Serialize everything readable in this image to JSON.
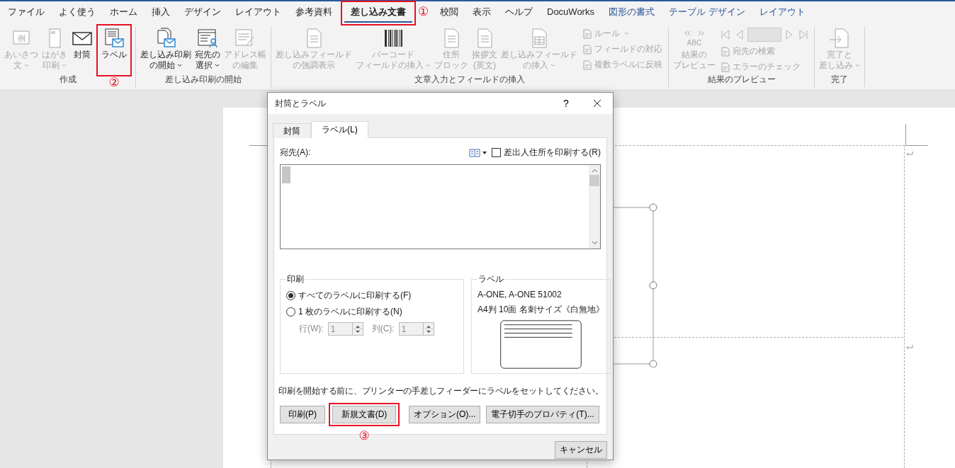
{
  "ribbon_tabs": [
    {
      "label": "ファイル",
      "selected": false,
      "kind": "normal"
    },
    {
      "label": "よく使う",
      "selected": false,
      "kind": "normal"
    },
    {
      "label": "ホーム",
      "selected": false,
      "kind": "normal"
    },
    {
      "label": "挿入",
      "selected": false,
      "kind": "normal"
    },
    {
      "label": "デザイン",
      "selected": false,
      "kind": "normal"
    },
    {
      "label": "レイアウト",
      "selected": false,
      "kind": "normal"
    },
    {
      "label": "参考資料",
      "selected": false,
      "kind": "normal"
    },
    {
      "label": "差し込み文書",
      "selected": true,
      "kind": "normal",
      "callout": "①"
    },
    {
      "label": "校閲",
      "selected": false,
      "kind": "normal"
    },
    {
      "label": "表示",
      "selected": false,
      "kind": "normal"
    },
    {
      "label": "ヘルプ",
      "selected": false,
      "kind": "normal"
    },
    {
      "label": "DocuWorks",
      "selected": false,
      "kind": "normal"
    },
    {
      "label": "図形の書式",
      "selected": false,
      "kind": "context"
    },
    {
      "label": "テーブル デザイン",
      "selected": false,
      "kind": "context"
    },
    {
      "label": "レイアウト",
      "selected": false,
      "kind": "context"
    }
  ],
  "ribbon_groups": [
    {
      "label": "作成",
      "commands": [
        {
          "kind": "large",
          "lines": [
            "あいさつ",
            "文"
          ],
          "dropdown": true,
          "disabled": true,
          "icon_text": "例"
        },
        {
          "kind": "large",
          "lines": [
            "はがき",
            "印刷"
          ],
          "dropdown": true,
          "disabled": true
        },
        {
          "kind": "large",
          "lines": [
            "封筒"
          ],
          "dropdown": false,
          "disabled": false
        },
        {
          "kind": "large",
          "lines": [
            "ラベル"
          ],
          "dropdown": false,
          "disabled": false,
          "callout": "②"
        }
      ]
    },
    {
      "label": "差し込み印刷の開始",
      "commands": [
        {
          "kind": "large",
          "lines": [
            "差し込み印刷",
            "の開始"
          ],
          "dropdown": true,
          "disabled": false
        },
        {
          "kind": "large",
          "lines": [
            "宛先の",
            "選択"
          ],
          "dropdown": true,
          "disabled": false
        },
        {
          "kind": "large",
          "lines": [
            "アドレス帳",
            "の編集"
          ],
          "dropdown": false,
          "disabled": true
        }
      ]
    },
    {
      "label": "文章入力とフィールドの挿入",
      "commands": [
        {
          "kind": "large",
          "lines": [
            "差し込みフィールド",
            "の強調表示"
          ],
          "dropdown": false,
          "disabled": true
        },
        {
          "kind": "large",
          "lines": [
            "バーコード",
            "フィールドの挿入"
          ],
          "dropdown": true,
          "disabled": true
        },
        {
          "kind": "large",
          "lines": [
            "住所",
            "ブロック"
          ],
          "dropdown": false,
          "disabled": true
        },
        {
          "kind": "large",
          "lines": [
            "挨拶文",
            "(英文)"
          ],
          "dropdown": false,
          "disabled": true
        },
        {
          "kind": "large",
          "lines": [
            "差し込みフィールド",
            "の挿入"
          ],
          "dropdown": true,
          "disabled": true
        },
        {
          "kind": "stack",
          "items": [
            {
              "kind": "small",
              "label": "ルール",
              "dropdown": true,
              "disabled": true
            },
            {
              "kind": "small",
              "label": "フィールドの対応",
              "dropdown": false,
              "disabled": true
            },
            {
              "kind": "small",
              "label": "複数ラベルに反映",
              "dropdown": false,
              "disabled": true
            }
          ]
        }
      ]
    },
    {
      "label": "結果のプレビュー",
      "commands": [
        {
          "kind": "large",
          "lines": [
            "結果の",
            "プレビュー"
          ],
          "dropdown": false,
          "disabled": true,
          "icon_text": "ABC"
        },
        {
          "kind": "stack",
          "items": [
            {
              "kind": "navigator",
              "disabled": true
            },
            {
              "kind": "small",
              "label": "宛先の検索",
              "dropdown": false,
              "disabled": true
            },
            {
              "kind": "small",
              "label": "エラーのチェック",
              "dropdown": false,
              "disabled": true
            }
          ]
        }
      ]
    },
    {
      "label": "完了",
      "commands": [
        {
          "kind": "large",
          "lines": [
            "完了と",
            "差し込み"
          ],
          "dropdown": true,
          "disabled": true
        }
      ]
    }
  ],
  "dialog": {
    "title": "封筒とラベル",
    "help": "?",
    "tabs": [
      {
        "label": "封筒",
        "selected": false
      },
      {
        "label": "ラベル(L)",
        "selected": true
      }
    ],
    "address_label": "宛先(A):",
    "return_address": {
      "label": "差出人住所を印刷する(R)",
      "checked": false
    },
    "print_group": {
      "title": "印刷",
      "options": [
        {
          "label": "すべてのラベルに印刷する(F)",
          "selected": true
        },
        {
          "label": "1 枚のラベルに印刷する(N)",
          "selected": false
        }
      ],
      "spinners": [
        {
          "label": "行(W):",
          "value": "1",
          "disabled": true
        },
        {
          "label": "列(C):",
          "value": "1",
          "disabled": true
        }
      ]
    },
    "label_group": {
      "title": "ラベル",
      "lines": [
        "A-ONE, A-ONE 51002",
        "A4判 10面 名刺サイズ《白無地》"
      ]
    },
    "note": "印刷を開始する前に、プリンターの手差しフィーダーにラベルをセットしてください。",
    "buttons": [
      {
        "label": "印刷(P)"
      },
      {
        "label": "新規文書(D)",
        "callout": "③"
      },
      {
        "label": "オプション(O)..."
      },
      {
        "label": "電子切手のプロパティ(T)..."
      }
    ],
    "cancel": "キャンセル"
  }
}
